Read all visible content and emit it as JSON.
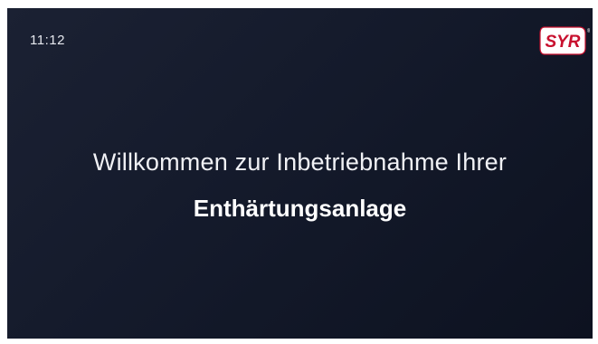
{
  "status_bar": {
    "time": "11:12"
  },
  "brand": {
    "logo_text": "SYR",
    "registered_mark": "®"
  },
  "welcome": {
    "line1": "Willkommen zur Inbetriebnahme Ihrer",
    "line2": "Enthärtungsanlage"
  },
  "colors": {
    "background": "#141a2b",
    "text": "#ffffff"
  }
}
